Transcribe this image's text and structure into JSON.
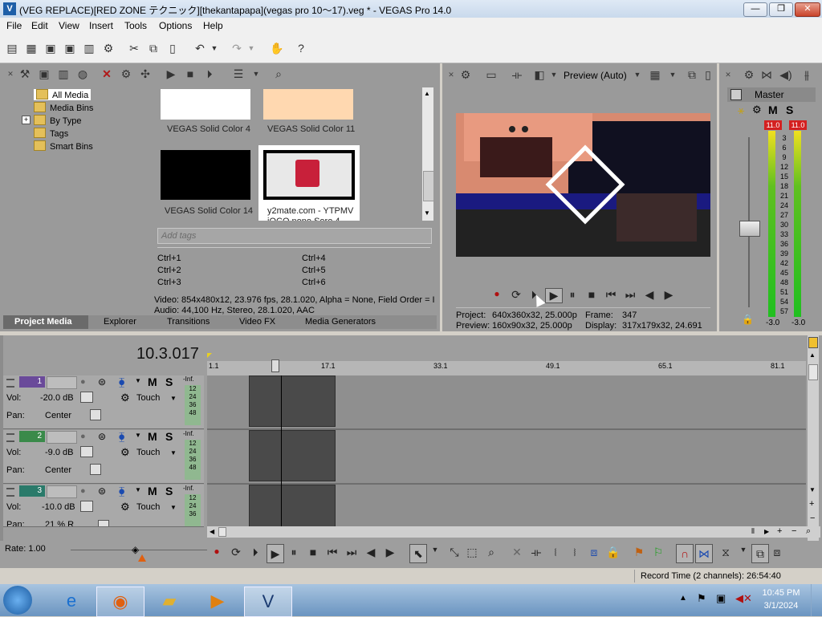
{
  "window": {
    "title": "(VEG REPLACE)[RED ZONE テクニック][thekantapapa](vegas pro 10～17).veg * - VEGAS Pro 14.0",
    "minimize": "—",
    "restore": "❐",
    "close": "✕"
  },
  "menu": {
    "items": [
      "File",
      "Edit",
      "View",
      "Insert",
      "Tools",
      "Options",
      "Help"
    ]
  },
  "media_panel": {
    "tree": [
      "All Media",
      "Media Bins",
      "By Type",
      "Tags",
      "Smart Bins"
    ],
    "expander": "+",
    "thumbnails": [
      {
        "label": "VEGAS Solid Color 4",
        "color": "#ffffff"
      },
      {
        "label": "VEGAS Solid Color 11",
        "color": "#ffd8b0"
      },
      {
        "label": "VEGAS Solid Color 14",
        "color": "#000000"
      },
      {
        "label": "y2mate.com - YTPMV",
        "label2": "iOCO nono Soro  4",
        "color": "#ffffff"
      }
    ],
    "tags_placeholder": "Add tags",
    "shortcuts_left": [
      "Ctrl+1",
      "Ctrl+2",
      "Ctrl+3"
    ],
    "shortcuts_right": [
      "Ctrl+4",
      "Ctrl+5",
      "Ctrl+6"
    ],
    "info_video": "Video: 854x480x12, 23.976 fps, 28.1.020, Alpha = None, Field Order = I",
    "info_audio": "Audio: 44,100 Hz, Stereo, 28.1.020, AAC",
    "tabs": [
      "Project Media",
      "Explorer",
      "Transitions",
      "Video FX",
      "Media Generators"
    ]
  },
  "preview": {
    "mode_label": "Preview (Auto)",
    "project_label": "Project:",
    "project_value": "640x360x32, 25.000p",
    "preview_label": "Preview:",
    "preview_value": "160x90x32, 25.000p",
    "frame_label": "Frame:",
    "frame_value": "347",
    "display_label": "Display:",
    "display_value": "317x179x32, 24.691"
  },
  "master": {
    "title": "Master",
    "m": "M",
    "s": "S",
    "peak_left": "11.0",
    "peak_right": "11.0",
    "scale": [
      "3",
      "6",
      "9",
      "12",
      "15",
      "18",
      "21",
      "24",
      "27",
      "30",
      "33",
      "36",
      "39",
      "42",
      "45",
      "48",
      "51",
      "54",
      "57"
    ],
    "bottom_left": "-3.0",
    "bottom_right": "-3.0",
    "peak_color": "#d42020"
  },
  "timeline": {
    "timecode": "10.3.017",
    "ruler": [
      "1.1",
      "17.1",
      "33.1",
      "49.1",
      "65.1",
      "81.1"
    ],
    "tracks": [
      {
        "num": "1",
        "vol_label": "Vol:",
        "vol": "-20.0 dB",
        "pan_label": "Pan:",
        "pan": "Center",
        "touch": "Touch",
        "inf": "-Inf.",
        "scale": [
          "12",
          "24",
          "36",
          "48"
        ],
        "color": "#6a4a9a"
      },
      {
        "num": "2",
        "vol_label": "Vol:",
        "vol": "-9.0 dB",
        "pan_label": "Pan:",
        "pan": "Center",
        "touch": "Touch",
        "inf": "-Inf.",
        "scale": [
          "12",
          "24",
          "36",
          "48"
        ],
        "color": "#3a8a4a"
      },
      {
        "num": "3",
        "vol_label": "Vol:",
        "vol": "-10.0 dB",
        "pan_label": "Pan:",
        "pan": "21 % R",
        "touch": "Touch",
        "inf": "-Inf.",
        "scale": [
          "12",
          "24",
          "36"
        ],
        "color": "#2a7a6a"
      }
    ],
    "m": "M",
    "s": "S"
  },
  "status": {
    "rate": "Rate: 1.00",
    "record_time": "Record Time (2 channels): 26:54:40"
  },
  "taskbar": {
    "time": "10:45 PM",
    "date": "3/1/2024"
  }
}
